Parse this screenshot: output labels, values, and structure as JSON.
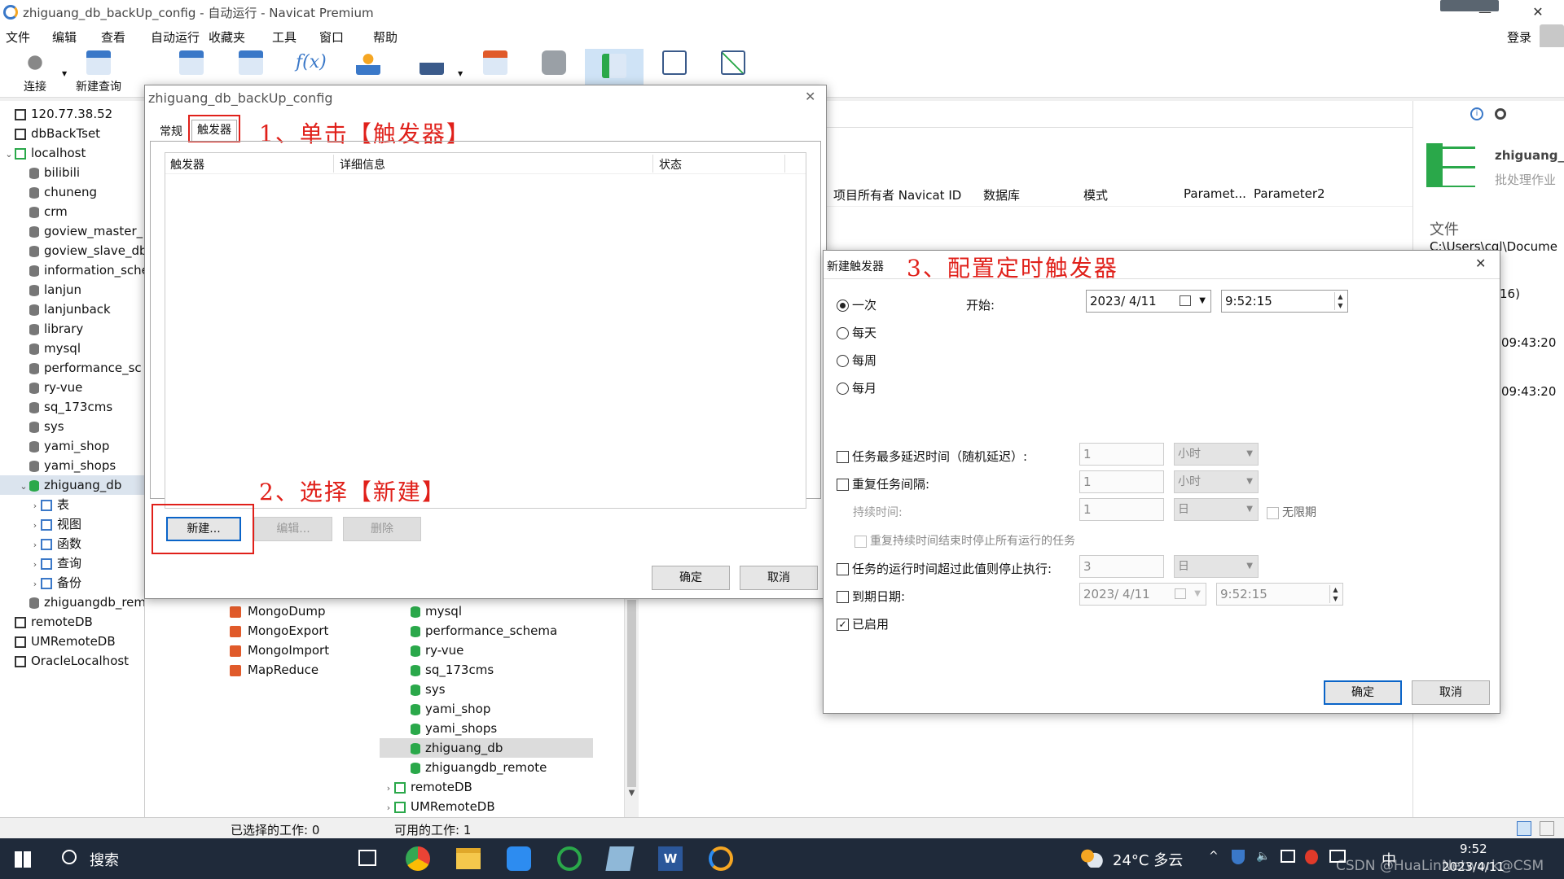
{
  "window": {
    "title": "zhiguang_db_backUp_config - 自动运行 - Navicat Premium",
    "min": "—",
    "close": "✕"
  },
  "menu": [
    "文件",
    "编辑",
    "查看",
    "自动运行",
    "收藏夹",
    "工具",
    "窗口",
    "帮助"
  ],
  "account": {
    "login": "登录"
  },
  "toolbar": {
    "connect": "连接",
    "new_query": "新建查询"
  },
  "sidebar": {
    "items": [
      {
        "label": "120.77.38.52",
        "type": "server"
      },
      {
        "label": "dbBackTset",
        "type": "server"
      },
      {
        "label": "localhost",
        "type": "server-green"
      },
      {
        "label": "bilibili",
        "type": "db"
      },
      {
        "label": "chuneng",
        "type": "db"
      },
      {
        "label": "crm",
        "type": "db"
      },
      {
        "label": "goview_master_",
        "type": "db"
      },
      {
        "label": "goview_slave_db",
        "type": "db"
      },
      {
        "label": "information_sche",
        "type": "db"
      },
      {
        "label": "lanjun",
        "type": "db"
      },
      {
        "label": "lanjunback",
        "type": "db"
      },
      {
        "label": "library",
        "type": "db"
      },
      {
        "label": "mysql",
        "type": "db"
      },
      {
        "label": "performance_sc",
        "type": "db"
      },
      {
        "label": "ry-vue",
        "type": "db"
      },
      {
        "label": "sq_173cms",
        "type": "db"
      },
      {
        "label": "sys",
        "type": "db"
      },
      {
        "label": "yami_shop",
        "type": "db"
      },
      {
        "label": "yami_shops",
        "type": "db"
      },
      {
        "label": "zhiguang_db",
        "type": "db-green"
      },
      {
        "label": "表",
        "type": "sub"
      },
      {
        "label": "视图",
        "type": "sub"
      },
      {
        "label": "函数",
        "type": "sub"
      },
      {
        "label": "查询",
        "type": "sub"
      },
      {
        "label": "备份",
        "type": "sub"
      },
      {
        "label": "zhiguangdb_remote",
        "type": "db"
      },
      {
        "label": "remoteDB",
        "type": "server"
      },
      {
        "label": "UMRemoteDB",
        "type": "server"
      },
      {
        "label": "OracleLocalhost",
        "type": "server"
      }
    ]
  },
  "mid_list": [
    "MongoDump",
    "MongoExport",
    "MongoImport",
    "MapReduce"
  ],
  "right_list": [
    "mysql",
    "performance_schema",
    "ry-vue",
    "sq_173cms",
    "sys",
    "yami_shop",
    "yami_shops",
    "zhiguang_db",
    "zhiguangdb_remote",
    "remoteDB",
    "UMRemoteDB"
  ],
  "table_header": [
    "项目所有者 Navicat ID",
    "数据库",
    "模式",
    "Paramet...",
    "Parameter2"
  ],
  "info_pane": {
    "name": "zhiguang_",
    "sub": "批处理作业",
    "file_label": "文件",
    "file_path": "C:\\Users\\cql\\Docume",
    "frag1": "16)",
    "time1": "09:43:20",
    "time2": "09:43:20"
  },
  "status": {
    "selected": "已选择的工作: 0",
    "available": "可用的工作: 1"
  },
  "dialog1": {
    "title": "zhiguang_db_backUp_config",
    "tab_general": "常规",
    "tab_trigger": "触发器",
    "col_trigger": "触发器",
    "col_detail": "详细信息",
    "col_status": "状态",
    "btn_new": "新建...",
    "btn_edit": "编辑...",
    "btn_delete": "删除",
    "btn_ok": "确定",
    "btn_cancel": "取消"
  },
  "annotations": {
    "a1": "1、单击【触发器】",
    "a2": "2、选择【新建】",
    "a3": "3、配置定时触发器"
  },
  "dialog2": {
    "title": "新建触发器",
    "once": "一次",
    "daily": "每天",
    "weekly": "每周",
    "monthly": "每月",
    "start_label": "开始:",
    "start_date": "2023/ 4/11",
    "start_time": "9:52:15",
    "delay_label": "任务最多延迟时间（随机延迟）:",
    "delay_val": "1",
    "delay_unit": "小时",
    "repeat_label": "重复任务间隔:",
    "repeat_val": "1",
    "repeat_unit": "小时",
    "duration_label": "持续时间:",
    "duration_val": "1",
    "duration_unit": "日",
    "unlimited": "无限期",
    "stop_all": "重复持续时间结束时停止所有运行的任务",
    "stop_if_label": "任务的运行时间超过此值则停止执行:",
    "stop_if_val": "3",
    "stop_if_unit": "日",
    "expire_label": "到期日期:",
    "expire_date": "2023/ 4/11",
    "expire_time": "9:52:15",
    "enabled_label": "已启用",
    "btn_ok": "确定",
    "btn_cancel": "取消"
  },
  "taskbar": {
    "search": "搜索",
    "weather": "24°C 多云",
    "ime": "中",
    "time": "9:52",
    "date": "2023/4/11",
    "watermark": "CSDN @HuaLinNetwork@CSM"
  }
}
